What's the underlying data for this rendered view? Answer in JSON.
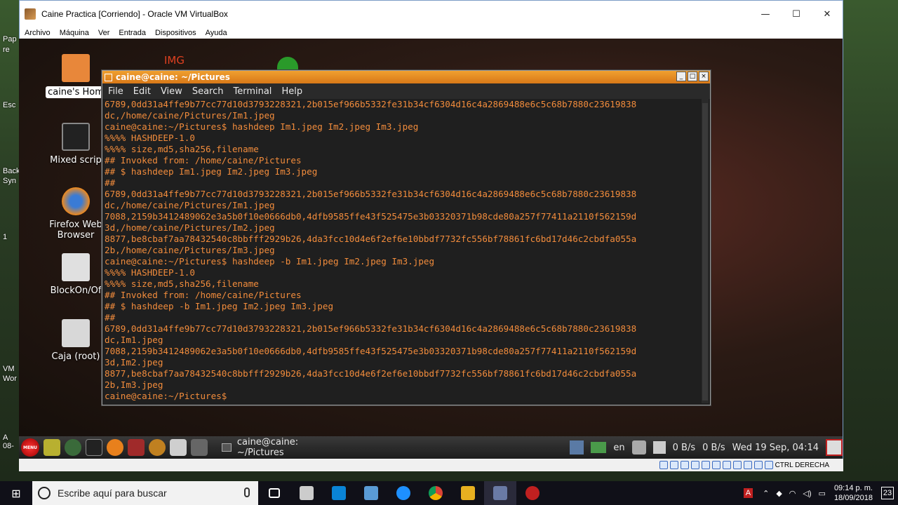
{
  "vbox": {
    "title": "Caine Practica [Corriendo] - Oracle VM VirtualBox",
    "menu": [
      "Archivo",
      "Máquina",
      "Ver",
      "Entrada",
      "Dispositivos",
      "Ayuda"
    ],
    "controls": [
      "—",
      "☐",
      "✕"
    ],
    "status_text": "CTRL DERECHA"
  },
  "host_edge": [
    "Pap",
    "re",
    "Esc",
    "Back",
    "Syn",
    "1",
    "A",
    "08-",
    "VM",
    "Wor"
  ],
  "desktop_icons": [
    {
      "label": "caine's Hom",
      "icon": "home-folder-icon",
      "selected": true
    },
    {
      "label": "Mixed scrip",
      "icon": "terminal-script-icon"
    },
    {
      "label": "Firefox Web\nBrowser",
      "icon": "firefox-icon"
    },
    {
      "label": "BlockOn/Of",
      "icon": "lock-icon"
    },
    {
      "label": "Caja (root)",
      "icon": "file-cabinet-icon"
    }
  ],
  "desktop_partial_labels": [
    "IMG"
  ],
  "terminal": {
    "title": "caine@caine: ~/Pictures",
    "menu": [
      "File",
      "Edit",
      "View",
      "Search",
      "Terminal",
      "Help"
    ],
    "lines": [
      "6789,0dd31a4ffe9b77cc77d10d3793228321,2b015ef966b5332fe31b34cf6304d16c4a2869488e6c5c68b7880c23619838",
      "dc,/home/caine/Pictures/Im1.jpeg",
      "caine@caine:~/Pictures$ hashdeep Im1.jpeg Im2.jpeg Im3.jpeg",
      "%%%% HASHDEEP-1.0",
      "%%%% size,md5,sha256,filename",
      "## Invoked from: /home/caine/Pictures",
      "## $ hashdeep Im1.jpeg Im2.jpeg Im3.jpeg",
      "##",
      "6789,0dd31a4ffe9b77cc77d10d3793228321,2b015ef966b5332fe31b34cf6304d16c4a2869488e6c5c68b7880c23619838",
      "dc,/home/caine/Pictures/Im1.jpeg",
      "7088,2159b3412489062e3a5b0f10e0666db0,4dfb9585ffe43f525475e3b03320371b98cde80a257f77411a2110f562159d",
      "3d,/home/caine/Pictures/Im2.jpeg",
      "8877,be8cbaf7aa78432540c8bbfff2929b26,4da3fcc10d4e6f2ef6e10bbdf7732fc556bf78861fc6bd17d46c2cbdfa055a",
      "2b,/home/caine/Pictures/Im3.jpeg",
      "caine@caine:~/Pictures$ hashdeep -b Im1.jpeg Im2.jpeg Im3.jpeg",
      "%%%% HASHDEEP-1.0",
      "%%%% size,md5,sha256,filename",
      "## Invoked from: /home/caine/Pictures",
      "## $ hashdeep -b Im1.jpeg Im2.jpeg Im3.jpeg",
      "##",
      "6789,0dd31a4ffe9b77cc77d10d3793228321,2b015ef966b5332fe31b34cf6304d16c4a2869488e6c5c68b7880c23619838",
      "dc,Im1.jpeg",
      "7088,2159b3412489062e3a5b0f10e0666db0,4dfb9585ffe43f525475e3b03320371b98cde80a257f77411a2110f562159d",
      "3d,Im2.jpeg",
      "8877,be8cbaf7aa78432540c8bbfff2929b26,4da3fcc10d4e6f2ef6e10bbdf7732fc556bf78861fc6bd17d46c2cbdfa055a",
      "2b,Im3.jpeg",
      "caine@caine:~/Pictures$"
    ]
  },
  "guest_taskbar": {
    "menu_label": "MENU",
    "task_item": "caine@caine: ~/Pictures",
    "lang": "en",
    "net_down": "0 B/s",
    "net_up": "0 B/s",
    "datetime": "Wed 19 Sep, 04:14"
  },
  "win_taskbar": {
    "search_placeholder": "Escribe aquí para buscar",
    "time": "09:14 p. m.",
    "date": "18/09/2018",
    "notification_count": "23",
    "app_colors": [
      "#5a9bd5",
      "#0078d7",
      "#1e90ff",
      "#0a84d6",
      "#e0a030",
      "#e8a020",
      "#4a4a6a",
      "#c02020"
    ]
  }
}
